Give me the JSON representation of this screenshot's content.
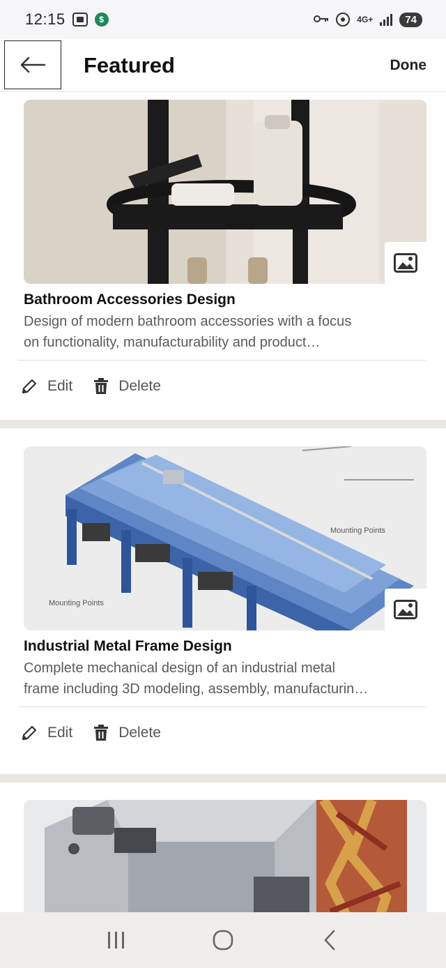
{
  "status_bar": {
    "time": "12:15",
    "app_badge": "$",
    "network": "4G+",
    "battery": "74"
  },
  "header": {
    "title": "Featured",
    "done_label": "Done"
  },
  "cards": [
    {
      "title": "Bathroom Accessories Design",
      "desc_line1": "Design of modern bathroom accessories with a focus",
      "desc_line2": "on functionality, manufacturability and product…",
      "edit_label": "Edit",
      "delete_label": "Delete"
    },
    {
      "title": "Industrial Metal Frame Design",
      "desc_line1": "Complete mechanical design of an industrial metal",
      "desc_line2": "frame including 3D modeling, assembly, manufacturin…",
      "edit_label": "Edit",
      "delete_label": "Delete",
      "image_labels": [
        "Mounting Points",
        "Mounting Points"
      ]
    }
  ],
  "colors": {
    "separator": "#e9e6e1",
    "nav_bg": "#efeeec",
    "text_secondary": "#5a5a5a"
  }
}
